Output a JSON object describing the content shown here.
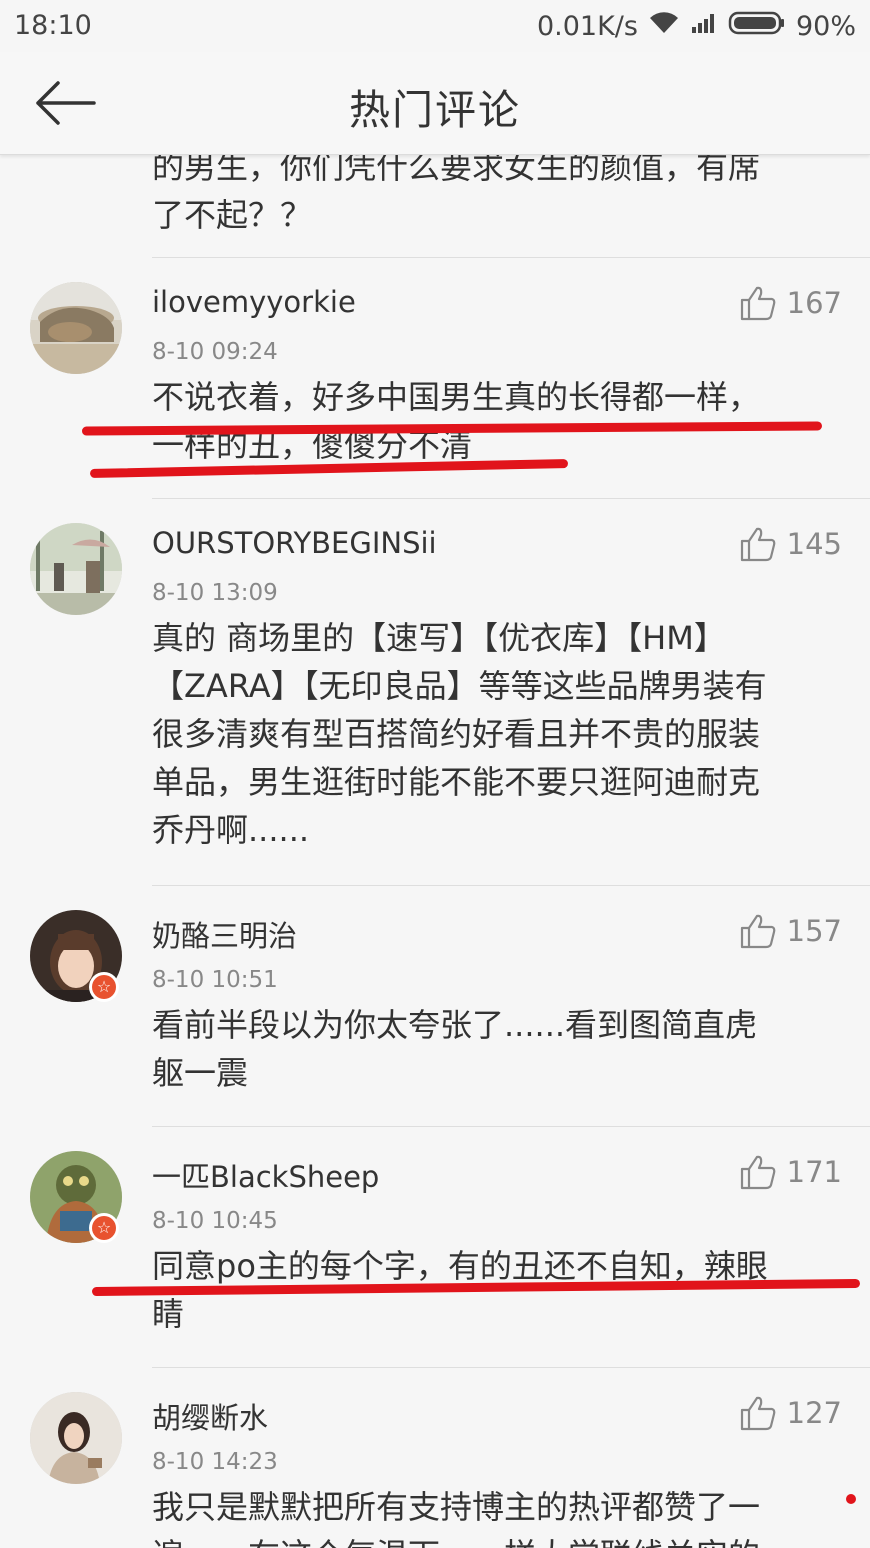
{
  "status_bar": {
    "time": "18:10",
    "speed": "0.01K/s",
    "battery": "90%"
  },
  "header": {
    "title": "热门评论"
  },
  "top_partial": {
    "line1": "的男生，你们凭什么要求女生的颜值，有席",
    "line2": "了不起？？"
  },
  "comments": [
    {
      "username": "ilovemyyorkie",
      "time": "8-10 09:24",
      "likes": "167",
      "lines": [
        "不说衣着，好多中国男生真的长得都一样，",
        "一样的丑，傻傻分不清"
      ]
    },
    {
      "username": "OURSTORYBEGINSii",
      "time": "8-10 13:09",
      "likes": "145",
      "lines": [
        "真的 商场里的【速写】【优衣库】【HM】",
        "【ZARA】【无印良品】等等这些品牌男装有",
        "很多清爽有型百搭简约好看且并不贵的服装",
        "单品，男生逛街时能不能不要只逛阿迪耐克",
        "乔丹啊......"
      ]
    },
    {
      "username": "奶酪三明治",
      "time": "8-10 10:51",
      "likes": "157",
      "lines": [
        "看前半段以为你太夸张了......看到图简直虎",
        "躯一震"
      ]
    },
    {
      "username": "一匹BlackSheep",
      "time": "8-10 10:45",
      "likes": "171",
      "lines": [
        "同意po主的每个字，有的丑还不自知，辣眼",
        "睛"
      ]
    },
    {
      "username": "胡缨断水",
      "time": "8-10 14:23",
      "likes": "127",
      "lines": [
        "我只是默默把所有支持博主的热评都赞了一",
        "遍……在这个气温下，一样大学联线关实的"
      ]
    }
  ],
  "colors": {
    "highlight_red": "#e1141b",
    "badge_orange": "#e8522f"
  },
  "icons": [
    "back-arrow-icon",
    "wifi-icon",
    "signal-icon",
    "battery-icon",
    "thumbs-up-icon",
    "verified-badge-icon"
  ]
}
